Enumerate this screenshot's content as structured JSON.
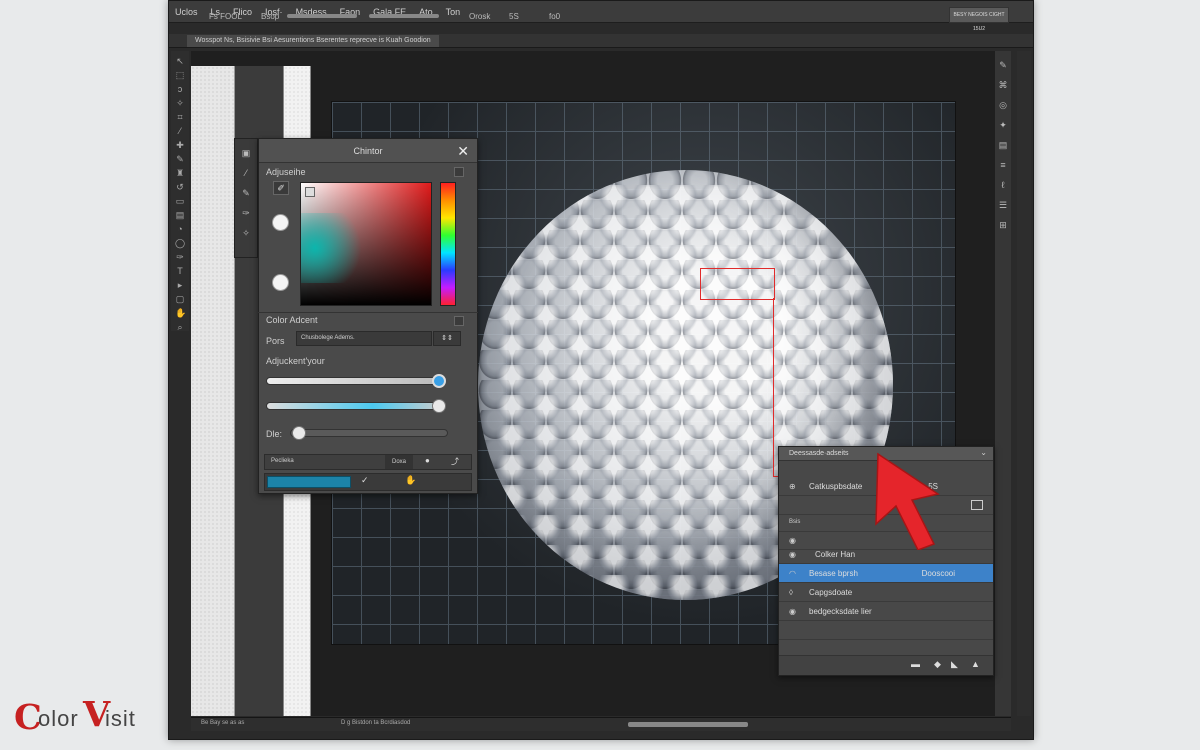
{
  "menubar": {
    "items": [
      "Uclos",
      "Ls",
      "Flico",
      "Iosf·",
      "Msdess",
      "Faon",
      "Gala FE",
      "Ato",
      "Ton"
    ],
    "options": [
      "Fs FOOL",
      "Bsop",
      "Orosk",
      "5S",
      "fo0"
    ],
    "right_button": "BESY NEGOIS CIGHT 15U2"
  },
  "tab": {
    "label": "Wosspot Ns, Bsisivie Bsi Aesurentions Bserentes reprecve is Kuah Goodion"
  },
  "color_picker": {
    "title": "Chintor",
    "adjust_label": "Adjuseihe",
    "color_adjust_label": "Color Adcent",
    "pors_label": "Pors",
    "pors_value": "Chusbolege Adems.",
    "adjustment_label": "Adjuckent'your",
    "die_label": "Dle:",
    "footer_left": "Peclieka",
    "footer_button": "Doxa"
  },
  "layers": {
    "header": "Deessasde·adseits",
    "rows": [
      {
        "icon": "⊕",
        "label": "Catkuspbsdate",
        "right": "5S"
      },
      {
        "icon": "Bsis",
        "label": ""
      },
      {
        "icon": "◉",
        "label": "Colker Han"
      },
      {
        "icon": "◠",
        "label": "Besase bprsh",
        "right": "Dooscooi"
      },
      {
        "icon": "◊",
        "label": "Capgsdoate"
      },
      {
        "icon": "◉",
        "label": "bedgecksdate lier"
      }
    ]
  },
  "statusbar": {
    "left": "Be Bay se as as",
    "mid": "D ɡ Bistdon ta Bcrdiasdod"
  },
  "logo": {
    "c": "C",
    "w1": "olor",
    "v": "V",
    "w2": "isit"
  },
  "colors": {
    "accent": "#3d82c9",
    "selection": "#e12b2b",
    "cursor": "#e5252b"
  }
}
